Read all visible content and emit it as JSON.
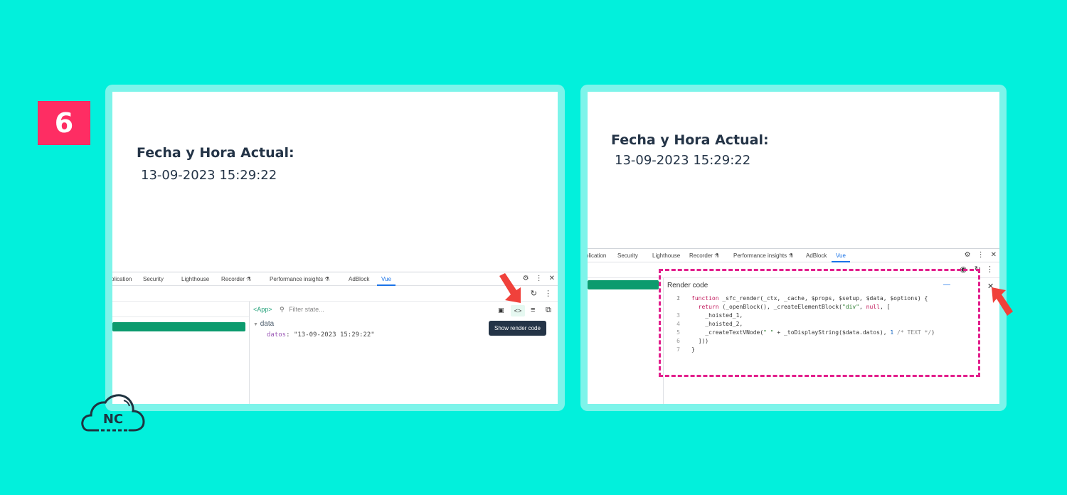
{
  "step": {
    "number": "6"
  },
  "app": {
    "title": "Fecha y Hora Actual:",
    "value": "13-09-2023 15:29:22"
  },
  "devtools": {
    "tabs_left": [
      "plication",
      "Security",
      "Lighthouse",
      "Recorder ⚗",
      "Performance insights ⚗",
      "AdBlock",
      "Vue"
    ],
    "tabs_right": [
      "plication",
      "Security",
      "Lighthouse",
      "Recorder ⚗",
      "Performance insights ⚗",
      "AdBlock",
      "Vue"
    ],
    "breadcrumb": "<App>",
    "filter_placeholder": "Filter state...",
    "tooltip": "Show render code",
    "state_section": "data",
    "state_key": "datos",
    "state_value": "\"13-09-2023 15:29:22\""
  },
  "render": {
    "title": "Render code",
    "line_numbers": [
      "1",
      "2",
      "3",
      "4",
      "5",
      "6",
      "7"
    ],
    "lines": [
      {
        "pre": "",
        "kw": "function",
        "rest": " _sfc_render(_ctx, _cache, $props, $setup, $data, $options) {"
      },
      {
        "pre": "  ",
        "kw": "return",
        "rest": " (_openBlock(), _createElementBlock(",
        "str": "\"div\"",
        "rest2": ", ",
        "kw2": "null",
        "rest3": ", ["
      },
      {
        "pre": "    _hoisted_1,"
      },
      {
        "pre": "    _hoisted_2,"
      },
      {
        "pre": "    _createTextVNode(",
        "str": "\" \"",
        "rest": " + _toDisplayString($data.datos), ",
        "num": "1",
        "cm": " /* TEXT */",
        "rest2": ")"
      },
      {
        "pre": "  ]))"
      },
      {
        "pre": "}"
      }
    ]
  },
  "brand": {
    "logo_text": "NC"
  },
  "colors": {
    "background": "#02f0dc",
    "badge": "#fe2d63",
    "highlight": "#e21e8c",
    "arrow": "#f0413b",
    "vue_green": "#0c9b6e"
  }
}
